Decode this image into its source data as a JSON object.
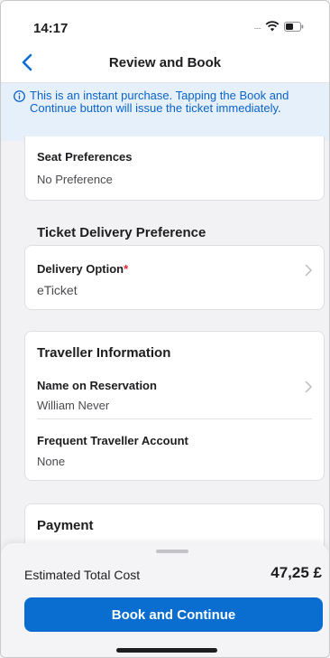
{
  "status_bar": {
    "time": "14:17",
    "signal_dots": "....."
  },
  "nav": {
    "title": "Review and Book"
  },
  "banner": {
    "text": "This is an instant purchase. Tapping the Book and Continue button will issue the ticket immediately."
  },
  "seat": {
    "label": "Seat Preferences",
    "value": "No Preference"
  },
  "delivery": {
    "heading": "Ticket Delivery Preference",
    "option_label": "Delivery Option",
    "required_mark": "*",
    "option_value": "eTicket"
  },
  "traveller": {
    "heading": "Traveller Information",
    "name_label": "Name on Reservation",
    "name_value": "William Never",
    "ffa_label": "Frequent Traveller Account",
    "ffa_value": "None"
  },
  "payment": {
    "heading": "Payment"
  },
  "footer": {
    "total_label": "Estimated Total Cost",
    "total_value": "47,25 £",
    "book_button": "Book and Continue"
  },
  "colors": {
    "accent": "#0a6ed1",
    "banner_bg": "#e6f0fb",
    "banner_text": "#0a63c9",
    "required": "#d8262f"
  },
  "icons": [
    "back-chevron-icon",
    "info-icon",
    "wifi-icon",
    "battery-icon",
    "chevron-right-icon"
  ]
}
